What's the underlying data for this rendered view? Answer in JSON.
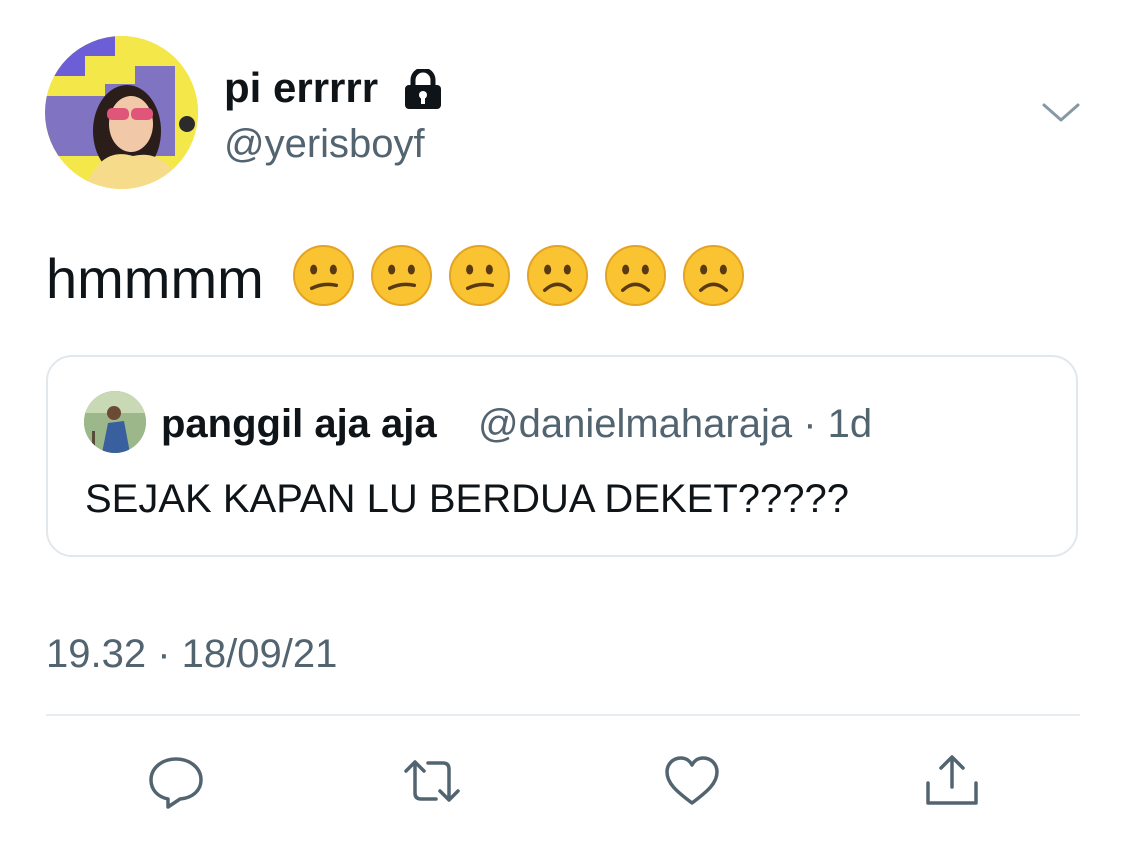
{
  "tweet": {
    "display_name": "pi errrrr",
    "handle": "@yerisboyf",
    "text": "hmmmm",
    "emojis": [
      "confused-face-icon",
      "confused-face-icon",
      "confused-face-icon",
      "frowning-face-icon",
      "frowning-face-icon",
      "frowning-face-icon"
    ],
    "timestamp": "19.32 · 18/09/21",
    "protected_icon": "lock-icon",
    "menu_icon": "chevron-down-icon"
  },
  "quote": {
    "display_name": "panggil aja aja",
    "handle_and_time": "@danielmaharaja · 1d",
    "text": "SEJAK KAPAN LU BERDUA DEKET?????"
  },
  "actions": [
    "reply-icon",
    "retweet-icon",
    "like-icon",
    "share-icon"
  ],
  "colors": {
    "text": "#0f1419",
    "secondary": "#536471",
    "border": "#e1e8ed",
    "emoji": "#f9c332"
  }
}
